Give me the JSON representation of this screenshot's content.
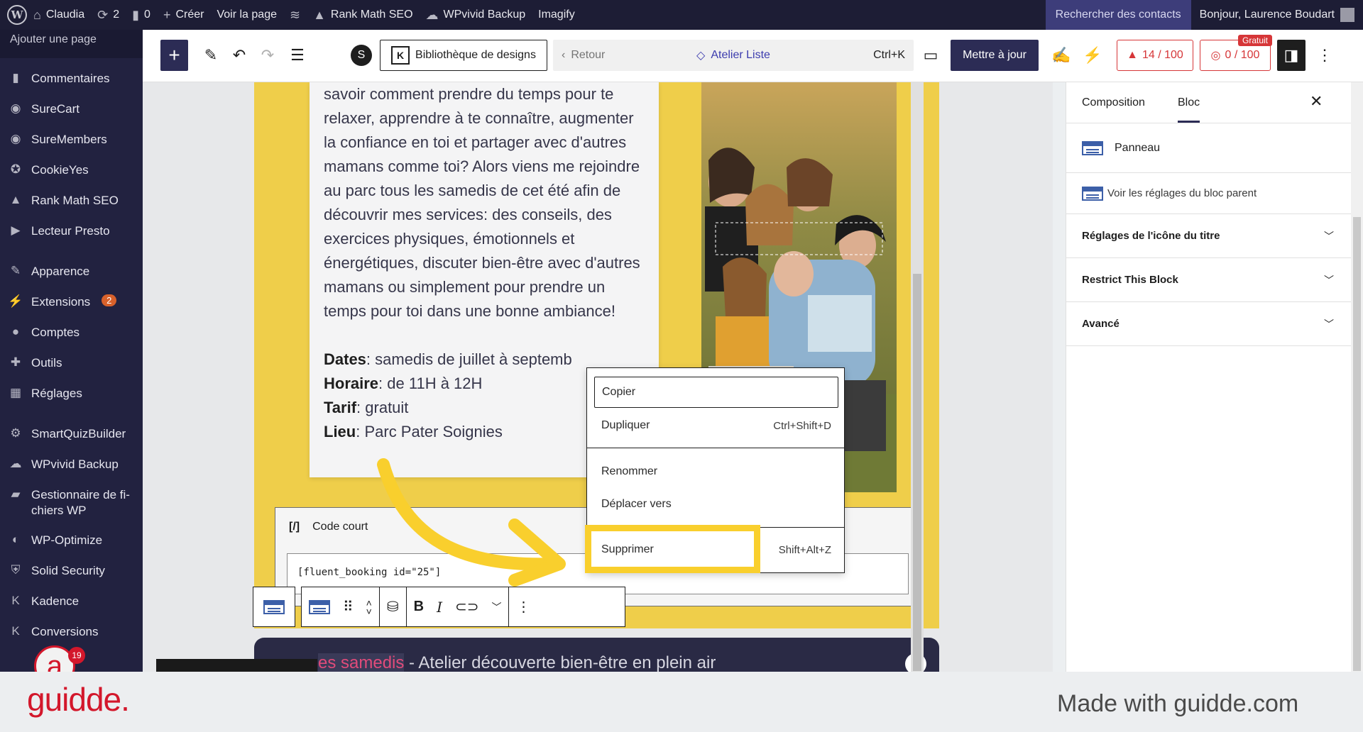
{
  "adminbar": {
    "site_name": "Claudia",
    "updates_count": "2",
    "comments_count": "0",
    "new_label": "Créer",
    "view_page": "Voir la page",
    "rankmath": "Rank Math SEO",
    "wpvivid": "WPvivid Backup",
    "imagify": "Imagify",
    "search_contacts": "Rechercher des contacts",
    "greeting": "Bonjour, Laurence Boudart"
  },
  "sidebar": {
    "submenu_item": "Ajouter une page",
    "items": [
      {
        "label": "Commentaires",
        "icon": "comment-icon"
      },
      {
        "label": "SureCart",
        "icon": "surecart-icon"
      },
      {
        "label": "SureMembers",
        "icon": "suremembers-icon"
      },
      {
        "label": "CookieYes",
        "icon": "cookieyes-icon"
      },
      {
        "label": "Rank Math SEO",
        "icon": "rankmath-icon"
      },
      {
        "label": "Lecteur Presto",
        "icon": "presto-icon"
      },
      {
        "label": "Apparence",
        "icon": "brush-icon"
      },
      {
        "label": "Extensions",
        "icon": "plugin-icon",
        "badge": "2"
      },
      {
        "label": "Comptes",
        "icon": "user-icon"
      },
      {
        "label": "Outils",
        "icon": "wrench-icon"
      },
      {
        "label": "Réglages",
        "icon": "settings-icon"
      },
      {
        "label": "SmartQuizBuilder",
        "icon": "gear-icon"
      },
      {
        "label": "WPvivid Backup",
        "icon": "cloud-icon"
      },
      {
        "label": "Gestionnaire de fi-chiers WP",
        "icon": "folder-icon"
      },
      {
        "label": "WP-Optimize",
        "icon": "optimize-icon"
      },
      {
        "label": "Solid Security",
        "icon": "shield-icon"
      },
      {
        "label": "Kadence",
        "icon": "kadence-icon"
      },
      {
        "label": "Conversions",
        "icon": "conversions-icon"
      }
    ]
  },
  "toolbar": {
    "design_library": "Bibliothèque de designs",
    "back": "Retour",
    "document_title": "Atelier Liste",
    "shortcut": "Ctrl+K",
    "update": "Mettre à jour",
    "seo_score": "14 / 100",
    "ai_score": "0 / 100",
    "free_badge": "Gratuit"
  },
  "content": {
    "paragraph": "savoir comment prendre du temps pour te relaxer, apprendre à te connaître, augmenter la confiance en toi et partager avec d'autres mamans comme toi? Alors viens me rejoindre au parc tous les samedis de cet été afin de découvrir mes services: des conseils, des exercices physiques, émotionnels et énergétiques, discuter bien-être avec d'autres mamans ou simplement pour prendre un temps pour toi dans une bonne ambiance!",
    "dates_label": "Dates",
    "dates_value": ": samedis de juillet à septemb",
    "hours_label": "Horaire",
    "hours_value": ": de 11H à 12H",
    "price_label": "Tarif",
    "price_value": ": gratuit",
    "place_label": "Lieu",
    "place_value": ": Parc Pater Soignies",
    "shortcode_title": "Code court",
    "shortcode_icon": "[/]",
    "shortcode_value": "[fluent_booking id=\"25\"]",
    "next_highlight": "es samedis",
    "next_title": " - Atelier découverte bien-être en plein air"
  },
  "context_menu": {
    "copy": "Copier",
    "duplicate": "Dupliquer",
    "duplicate_shortcut": "Ctrl+Shift+D",
    "rename": "Renommer",
    "move_to": "Déplacer vers",
    "delete": "Supprimer",
    "delete_shortcut": "Shift+Alt+Z"
  },
  "settings": {
    "tab_composition": "Composition",
    "tab_block": "Bloc",
    "block_name": "Panneau",
    "parent_link": "Voir les réglages du bloc parent",
    "sections": [
      "Réglages de l'icône du titre",
      "Restrict This Block",
      "Avancé"
    ]
  },
  "footer": {
    "brand": "guidde.",
    "made_with": "Made with guidde.com"
  },
  "avatar": {
    "letter": "a",
    "badge": "19"
  },
  "colors": {
    "admin_bg": "#1d1d35",
    "sidebar_bg": "#222240",
    "primary": "#2c2c55",
    "accent_yellow": "#f9cf2d",
    "brand_red": "#d3172b",
    "score_red": "#d63638"
  }
}
